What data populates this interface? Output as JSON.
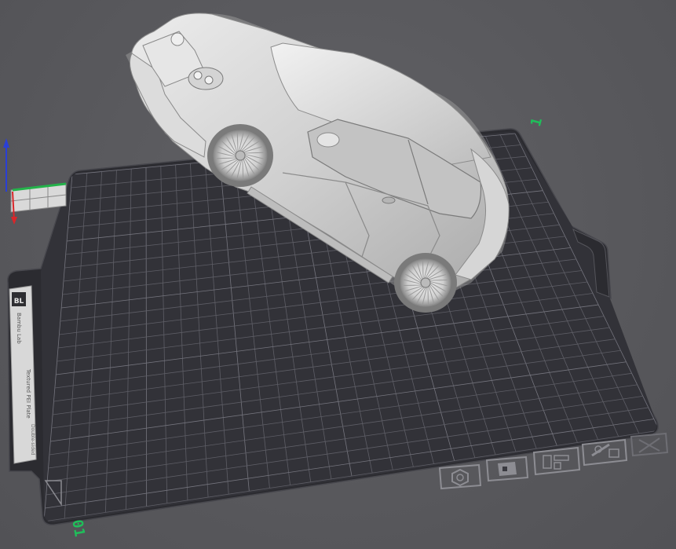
{
  "app": {
    "view": "3D build plate preview"
  },
  "plate": {
    "label_front": "01",
    "label_back": "1",
    "accent_color": "#1fbf5a",
    "surface_color": "#323238",
    "grid_color": "#5e5e66"
  },
  "sticker": {
    "brand": "BL",
    "line1": "Bambu Lab",
    "line2": "Textured PEI Plate",
    "line3": "Double-sided"
  },
  "axes": {
    "x_color": "#d9262a",
    "y_color": "#24b24a",
    "z_color": "#2a3fd6"
  },
  "plate_toolbar": [
    {
      "name": "auto-orient-icon"
    },
    {
      "name": "lock-plate-icon"
    },
    {
      "name": "arrange-icon"
    },
    {
      "name": "plate-settings-icon"
    },
    {
      "name": "delete-plate-icon"
    }
  ]
}
